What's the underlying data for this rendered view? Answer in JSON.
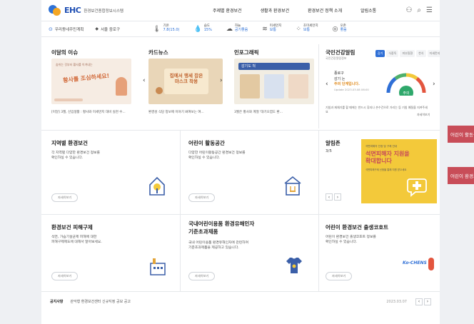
{
  "header": {
    "logo_text": "EHC",
    "logo_sub": "환경보건종합정보시스템",
    "nav": [
      "주제별 환경보건",
      "생활과 환경보건",
      "환경보건 정책 소개",
      "알림소통"
    ],
    "util_icons": [
      "user-icon",
      "search-icon",
      "menu-icon"
    ]
  },
  "weather": {
    "location": "우리동네주민계획",
    "region": "서울 중로구",
    "items": [
      {
        "icon": "thermometer-icon",
        "label": "기온",
        "value": "7.8(15.0)"
      },
      {
        "icon": "humidity-icon",
        "label": "습도",
        "value": "15%"
      },
      {
        "icon": "cloud-icon",
        "label": "하늘",
        "value": "공기좋음"
      },
      {
        "icon": "dust-icon",
        "label": "미세먼지",
        "value": "보통"
      },
      {
        "icon": "finedust-icon",
        "label": "초미세먼지",
        "value": "보통"
      },
      {
        "icon": "ozone-icon",
        "label": "오존",
        "value": "좋음"
      }
    ]
  },
  "row1": {
    "issue": {
      "title": "이달의 이슈",
      "img_text": "황사를 조심하세요!",
      "img_sub": "숨쉬는 것부터 황사를 이겨내는",
      "caption": "[이달] 3월, 신입생활 : 황사와 미세먼지 대비 실천 수..."
    },
    "cardnews": {
      "title": "카드뉴스",
      "img_text": "집에서 맹세 잡은 마스크 착용",
      "caption": "환경성 식당 정보에 이야기 봐여보는 여..."
    },
    "infographic": {
      "title": "인포그래픽",
      "img_text": "감기도 척",
      "caption": "3월은 황사와 계절 '대기오염도 환..."
    },
    "health": {
      "title": "국민건강알림",
      "subtitle": "국민건강알림정보",
      "tabs": [
        "감기",
        "식중독",
        "피부질환",
        "천식",
        "미세먼지"
      ],
      "active_tab": 0,
      "region": "종로구",
      "status_label": "감기 는",
      "status_value": "주의 단계입니다.",
      "update": "Update 2023.03.08 06:00",
      "tip": "기침과 재채기를 할 때에는 반드시 휴지나 손수건으로 가리는 등 기침 예절을 지켜주세요",
      "more": "자세히보기",
      "gauge_label": "주의",
      "gauge_value": 0.72
    }
  },
  "row2": {
    "local": {
      "title": "지역별 환경보건",
      "desc1": "각 지역별 다양한 환경보건 정보를",
      "desc2": "확인하실 수 있습니다.",
      "more": "자세히보기"
    },
    "kids": {
      "title": "어린이 활동공간",
      "desc1": "다양한 어린이활동공간 환경보건 정보를",
      "desc2": "확인하실 수 있습니다.",
      "more": "자세히보기"
    },
    "popup": {
      "title": "알림존",
      "page": "3/5",
      "banner_top": "석면피해자 인정 및 구제 안내",
      "banner_main1": "석면피해자 지원을",
      "banner_main2": "확대합니다",
      "banner_small": "석면피해구제 신청을 통해 지원 받으세요"
    }
  },
  "row3": {
    "damage": {
      "title": "환경보건 피해구제",
      "desc1": "석면, 가습기살균제 피해에 대한",
      "desc2": "피해구제제도에 대해서 알아보세요.",
      "more": "자세히보기"
    },
    "product": {
      "title1": "국내어린이용품 환경유해인자",
      "title2": "기준초과제품",
      "desc1": "국내 어린이용품 환경유해인자에 관련하여",
      "desc2": "기준초과제품을 제공하고 있습니다.",
      "more": "자세히보기"
    },
    "ecocode": {
      "title": "어린이 환경보건 출생코호트",
      "desc1": "어린이 환경보건 출생코호트 정보를",
      "desc2": "확인하실 수 있습니다.",
      "more": "자세히보기",
      "logo_text": "Ko-CHENS"
    }
  },
  "notice": {
    "label": "공지사항",
    "text": "관악형 환경보건센터 신규지정 공모 공고",
    "date": "2023.03.07"
  },
  "popups": [
    "어린이 활동공간",
    "어린이 환경보건"
  ],
  "colors": {
    "brand": "#1f4fb3",
    "accent": "#2f6fd6",
    "popup_red": "#c84d58",
    "banner_yellow": "#f3c93a",
    "gauge_green": "#2fa86b"
  }
}
